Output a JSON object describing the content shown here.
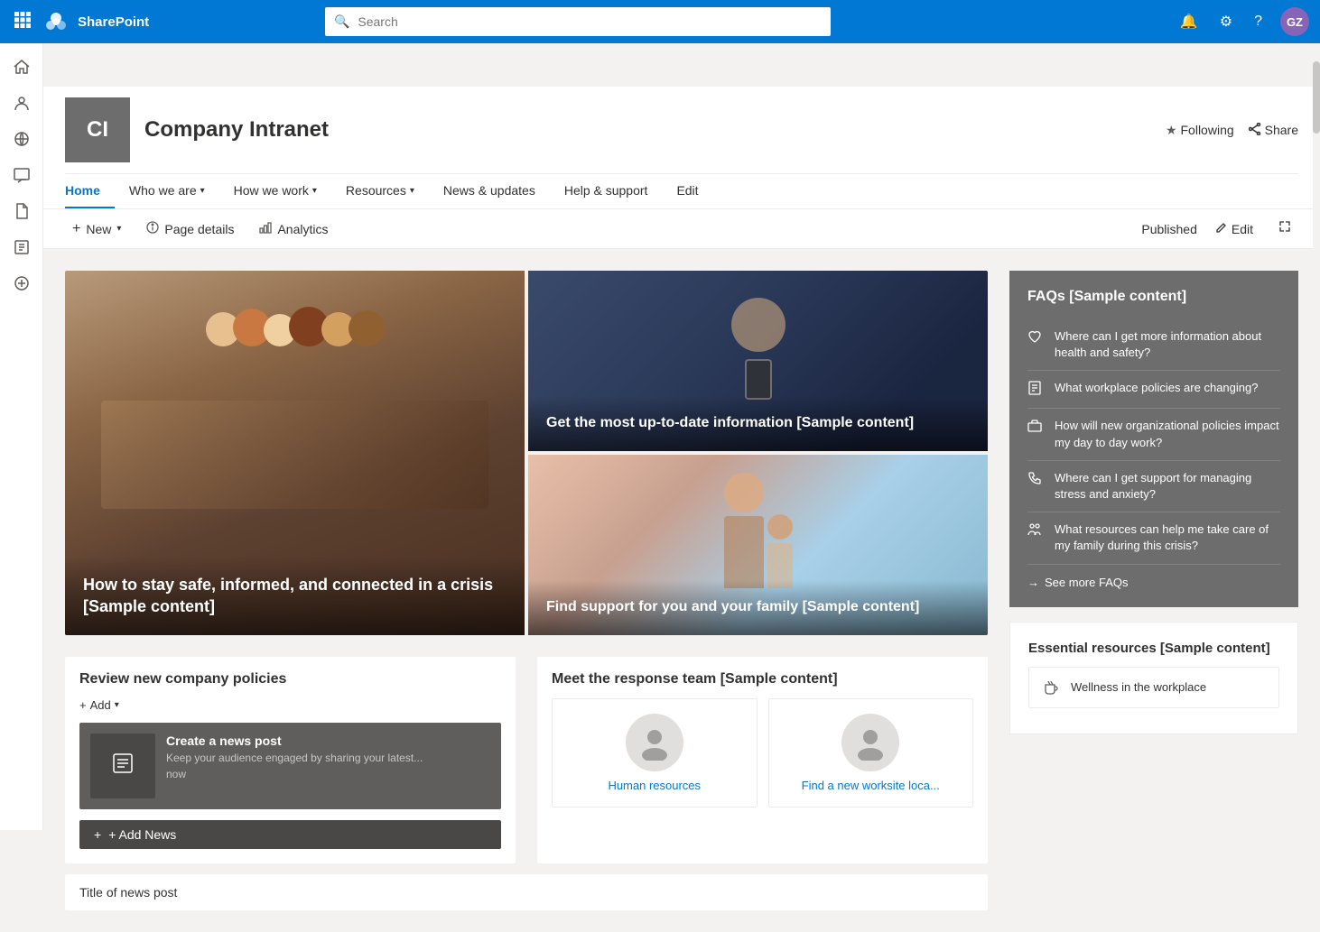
{
  "topbar": {
    "appname": "SharePoint",
    "search_placeholder": "Search",
    "avatar_initials": "GZ"
  },
  "sidebar": {
    "icons": [
      {
        "name": "home-icon",
        "glyph": "⌂",
        "active": false
      },
      {
        "name": "people-icon",
        "glyph": "👤",
        "active": false
      },
      {
        "name": "globe-icon",
        "glyph": "🌐",
        "active": false
      },
      {
        "name": "chat-icon",
        "glyph": "💬",
        "active": false
      },
      {
        "name": "document-icon",
        "glyph": "📄",
        "active": false
      },
      {
        "name": "list-icon",
        "glyph": "☰",
        "active": false
      },
      {
        "name": "plus-circle-icon",
        "glyph": "⊕",
        "active": false
      }
    ]
  },
  "site": {
    "logo": "CI",
    "title": "Company Intranet",
    "nav": [
      {
        "label": "Home",
        "active": true,
        "has_dropdown": false
      },
      {
        "label": "Who we are",
        "active": false,
        "has_dropdown": true
      },
      {
        "label": "How we work",
        "active": false,
        "has_dropdown": true
      },
      {
        "label": "Resources",
        "active": false,
        "has_dropdown": true
      },
      {
        "label": "News & updates",
        "active": false,
        "has_dropdown": false
      },
      {
        "label": "Help & support",
        "active": false,
        "has_dropdown": false
      },
      {
        "label": "Edit",
        "active": false,
        "has_dropdown": false
      }
    ],
    "actions": {
      "following": "Following",
      "share": "Share"
    }
  },
  "toolbar": {
    "new_label": "New",
    "page_details_label": "Page details",
    "analytics_label": "Analytics",
    "published_label": "Published",
    "edit_label": "Edit"
  },
  "hero": {
    "items": [
      {
        "title": "How to stay safe, informed, and connected in a crisis [Sample content]",
        "size": "large"
      },
      {
        "title": "Get the most up-to-date information [Sample content]",
        "size": "small-top"
      },
      {
        "title": "Find support for you and your family [Sample content]",
        "size": "small-bottom"
      }
    ]
  },
  "news_section": {
    "title": "Review new company policies",
    "add_label": "+ Add",
    "card": {
      "title": "Create a news post",
      "description": "Keep your audience engaged by sharing your latest...",
      "time": "now"
    },
    "add_news_label": "+ Add News"
  },
  "team_section": {
    "title": "Meet the response team [Sample content]",
    "members": [
      {
        "name": "Human resources"
      },
      {
        "name": "Find a new worksite loca..."
      }
    ]
  },
  "news_title_section": {
    "label": "Title of news post"
  },
  "faqs": {
    "title": "FAQs [Sample content]",
    "items": [
      {
        "icon": "heart-icon",
        "text": "Where can I get more information about health and safety?"
      },
      {
        "icon": "document-list-icon",
        "text": "What workplace policies are changing?"
      },
      {
        "icon": "briefcase-icon",
        "text": "How will new organizational policies impact my day to day work?"
      },
      {
        "icon": "phone-icon",
        "text": "Where can I get support for managing stress and anxiety?"
      },
      {
        "icon": "people-icon",
        "text": "What resources can help me take care of my family during this crisis?"
      }
    ],
    "see_more": "See more FAQs"
  },
  "resources": {
    "title": "Essential resources [Sample content]",
    "items": [
      {
        "icon": "coffee-icon",
        "text": "Wellness in the workplace"
      }
    ]
  }
}
